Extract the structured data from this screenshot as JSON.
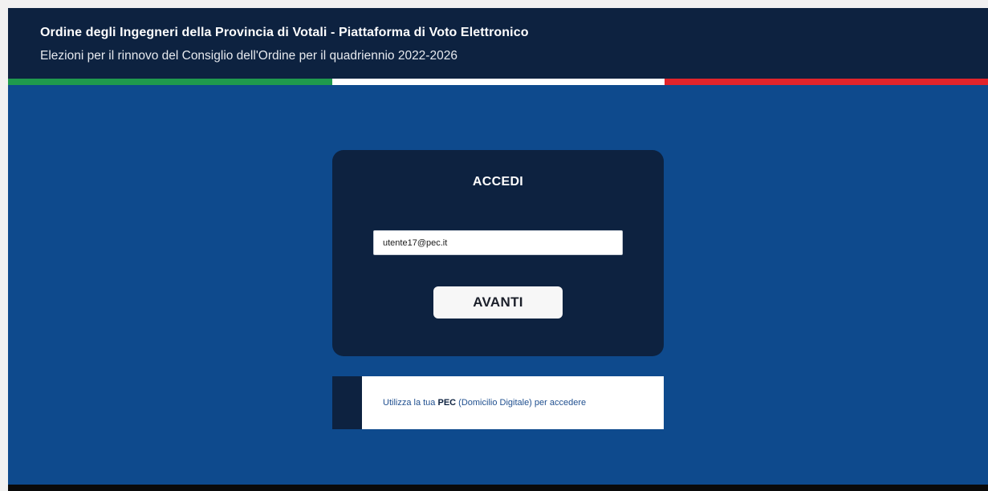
{
  "header": {
    "title": "Ordine degli Ingegneri della Provincia di Votali - Piattaforma di Voto Elettronico",
    "subtitle": "Elezioni per il rinnovo del Consiglio dell'Ordine per il quadriennio 2022-2026"
  },
  "colors": {
    "header_bg": "#0d2240",
    "page_bg": "#0e4a8d",
    "flag_green": "#1f9a4d",
    "flag_white": "#ffffff",
    "flag_red": "#e1242b"
  },
  "login": {
    "title": "ACCEDI",
    "email_value": "utente17@pec.it",
    "email_placeholder": "",
    "next_label": "AVANTI"
  },
  "info": {
    "text_before": "Utilizza la tua ",
    "text_strong": "PEC",
    "text_after": " (Domicilio Digitale) per accedere"
  }
}
